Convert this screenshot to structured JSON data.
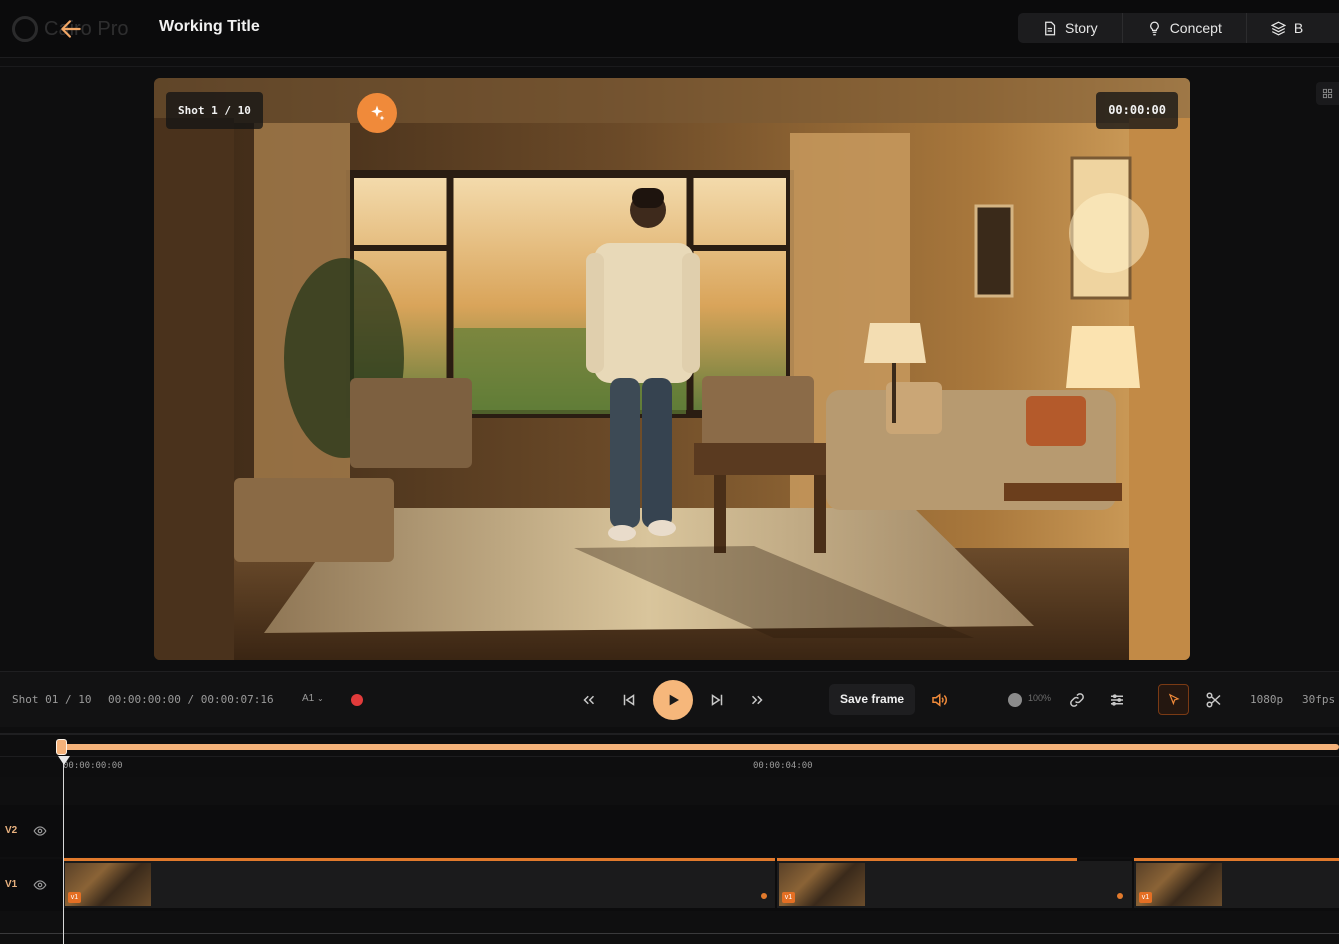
{
  "header": {
    "logo_text": "Cairo Pro",
    "title": "Working Title",
    "nav": [
      {
        "label": "Story",
        "icon": "document-icon"
      },
      {
        "label": "Concept",
        "icon": "lightbulb-icon"
      },
      {
        "label": "B",
        "icon": "layers-icon"
      }
    ]
  },
  "preview": {
    "shot_label": "Shot 1 / 10",
    "timecode": "00:00:00"
  },
  "controls": {
    "shot_counter": "Shot 01 / 10",
    "time_display": "00:00:00:00 / 00:00:07:16",
    "audio_track": "A1",
    "save_frame_label": "Save frame",
    "volume_percent": "100%",
    "resolution": "1080p",
    "fps": "30fps"
  },
  "timeline": {
    "ruler": [
      "00:00:00:00",
      "00:00:04:00"
    ],
    "tracks": [
      {
        "label": "V2"
      },
      {
        "label": "V1"
      }
    ],
    "clip_badge": "v1"
  },
  "colors": {
    "accent": "#f08a3a",
    "play": "#f6b77b",
    "record": "#e23b3b"
  }
}
